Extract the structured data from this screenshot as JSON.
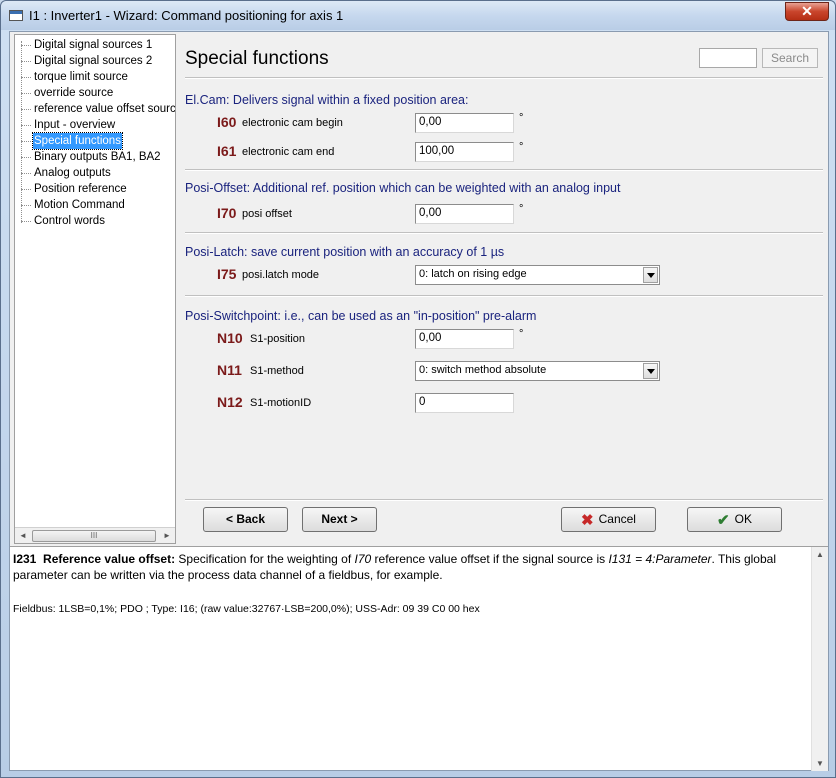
{
  "window": {
    "title": "I1 : Inverter1 - Wizard: Command positioning for axis 1",
    "close_label": "✕"
  },
  "tree": {
    "items": [
      {
        "label": "Digital signal sources 1"
      },
      {
        "label": "Digital signal sources 2"
      },
      {
        "label": "torque limit source"
      },
      {
        "label": "override source"
      },
      {
        "label": "reference value offset source"
      },
      {
        "label": "Input - overview"
      },
      {
        "label": "Special functions",
        "selected": true
      },
      {
        "label": "Binary outputs BA1, BA2"
      },
      {
        "label": "Analog outputs"
      },
      {
        "label": "Position reference"
      },
      {
        "label": "Motion Command"
      },
      {
        "label": "Control words"
      }
    ],
    "scroll_left": "◄",
    "scroll_right": "►",
    "thumb_grip": "III"
  },
  "page": {
    "title": "Special functions",
    "search_value": "",
    "search_label": "Search"
  },
  "sections": {
    "elcam": {
      "title": "El.Cam: Delivers signal within a fixed position area:",
      "params": [
        {
          "code": "I60",
          "name": "electronic cam begin",
          "value": "0,00",
          "unit": "°"
        },
        {
          "code": "I61",
          "name": "electronic cam end",
          "value": "100,00",
          "unit": "°"
        }
      ]
    },
    "posioffset": {
      "title": "Posi-Offset: Additional ref. position which can be weighted with an analog input",
      "params": [
        {
          "code": "I70",
          "name": "posi offset",
          "value": "0,00",
          "unit": "°"
        }
      ]
    },
    "posilatch": {
      "title": "Posi-Latch: save current position with an accuracy of 1 µs",
      "params": [
        {
          "code": "I75",
          "name": "posi.latch mode",
          "selected": "0: latch on rising edge"
        }
      ]
    },
    "posiswitch": {
      "title": "Posi-Switchpoint: i.e., can be used as an \"in-position\" pre-alarm",
      "params": [
        {
          "code": "N10",
          "name": "S1-position",
          "value": "0,00",
          "unit": "°"
        },
        {
          "code": "N11",
          "name": "S1-method",
          "selected": "0: switch method absolute"
        },
        {
          "code": "N12",
          "name": "S1-motionID",
          "value": "0"
        }
      ]
    }
  },
  "buttons": {
    "back": "< Back",
    "next": "Next >",
    "cancel": "Cancel",
    "ok": "OK"
  },
  "help": {
    "code": "I231",
    "name": "Reference value offset:",
    "text_1": " Specification for the weighting of ",
    "ref_param": "I70",
    "text_2": " reference value offset if the signal source is ",
    "ref_value": "I131 = 4:Parameter",
    "text_3": ". This global parameter can be written via the process data channel of a fieldbus, for example.",
    "fieldbus": "Fieldbus: 1LSB=0,1%; PDO ; Type: I16; (raw value:32767·LSB=200,0%); USS-Adr: 09 39 C0 00 hex",
    "scroll_up": "▲",
    "scroll_down": "▼"
  },
  "colors": {
    "param_code": "#7b1a1a",
    "section_title": "#1a237e",
    "selection": "#3399ff",
    "cancel_icon": "#c62828",
    "ok_icon": "#2e7d32"
  }
}
